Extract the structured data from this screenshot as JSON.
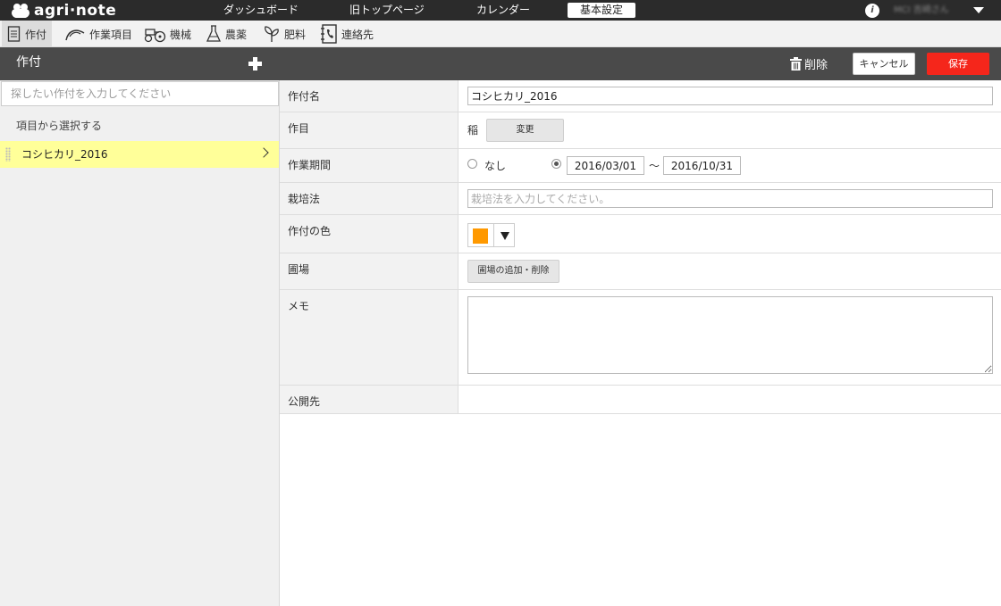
{
  "topbar": {
    "logo_text": "agri·note",
    "nav": [
      "ダッシュボード",
      "旧トップページ",
      "カレンダー",
      "基本設定"
    ],
    "active_nav": "基本設定",
    "user_name": "MCI 吉崎さん"
  },
  "modules": [
    "作付",
    "作業項目",
    "機械",
    "農薬",
    "肥料",
    "連絡先"
  ],
  "header": {
    "title": "作付",
    "delete_label": "削除",
    "cancel_label": "キャンセル",
    "save_label": "保存"
  },
  "sidebar": {
    "search_placeholder": "探したい作付を入力してください",
    "select_label": "項目から選択する",
    "items": [
      {
        "name": "コシヒカリ_2016"
      }
    ]
  },
  "form": {
    "crop_name_label": "作付名",
    "crop_name_value": "コシヒカリ_2016",
    "crop_type_label": "作目",
    "crop_type_value": "稲",
    "change_button": "変更",
    "period_label": "作業期間",
    "period_none": "なし",
    "period_start": "2016/03/01",
    "period_sep": "〜",
    "period_end": "2016/10/31",
    "method_label": "栽培法",
    "method_placeholder": "栽培法を入力してください。",
    "color_label": "作付の色",
    "color_value": "#ff9900",
    "field_label": "圃場",
    "field_button": "圃場の追加・削除",
    "memo_label": "メモ",
    "memo_value": "",
    "publish_label": "公開先"
  }
}
